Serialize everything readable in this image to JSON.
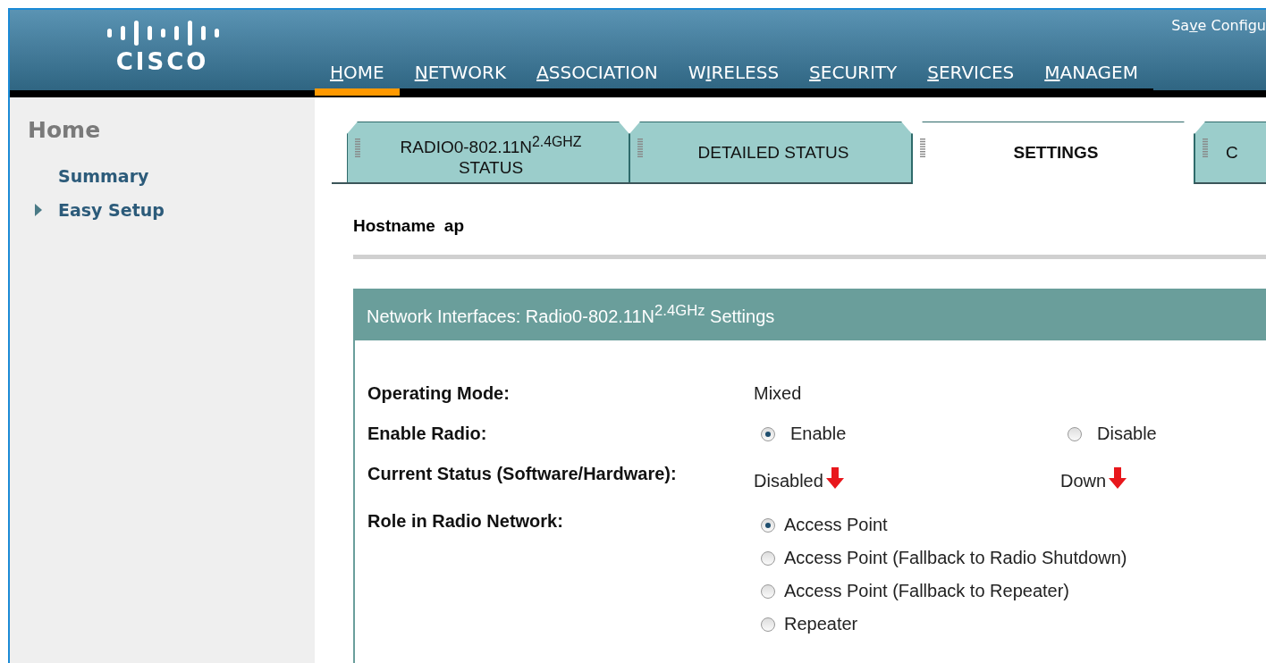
{
  "header": {
    "logo": "CISCO",
    "save_link": {
      "before": "Sa",
      "key": "v",
      "after": "e Configu"
    },
    "nav": [
      {
        "key": "H",
        "after": "OME",
        "selected": true
      },
      {
        "key": "N",
        "after": "ETWORK",
        "selected": false
      },
      {
        "key": "A",
        "after": "SSOCIATION",
        "selected": false
      },
      {
        "before": "W",
        "key": "I",
        "after": "RELESS",
        "selected": false
      },
      {
        "key": "S",
        "after": "ECURITY",
        "selected": false
      },
      {
        "key": "S",
        "after": "ERVICES",
        "selected": false
      },
      {
        "key": "M",
        "after": "ANAGEM",
        "selected": false
      }
    ]
  },
  "sidebar": {
    "title": "Home",
    "items": [
      {
        "label": "Summary",
        "expandable": false
      },
      {
        "label": "Easy Setup",
        "expandable": true
      }
    ]
  },
  "tabs": [
    {
      "label": "RADIO0-802.11N$^{2.4GHZ}$ STATUS",
      "selected": false
    },
    {
      "label": "DETAILED STATUS",
      "selected": false
    },
    {
      "label": "SETTINGS",
      "selected": true
    },
    {
      "label": "C",
      "selected": false
    }
  ],
  "hostname": {
    "label": "Hostname",
    "value": "ap"
  },
  "panel": {
    "title": "Network Interfaces: Radio0-802.11N$^{2.4GHz}$ Settings",
    "rows": [
      {
        "kind": "text",
        "label": "Operating Mode:",
        "value": "Mixed"
      },
      {
        "kind": "radio-inline",
        "label": "Enable Radio:",
        "options": [
          {
            "label": "Enable",
            "selected": true
          },
          {
            "label": "Disable",
            "selected": false
          }
        ]
      },
      {
        "kind": "status",
        "label": "Current Status (Software/Hardware):",
        "values": [
          {
            "text": "Disabled",
            "down": true
          },
          {
            "text": "Down",
            "down": true
          }
        ]
      },
      {
        "kind": "radio-list",
        "label": "Role in Radio Network:",
        "options": [
          {
            "label": "Access Point",
            "selected": true
          },
          {
            "label": "Access Point (Fallback to Radio Shutdown)",
            "selected": false
          },
          {
            "label": "Access Point (Fallback to Repeater)",
            "selected": false
          },
          {
            "label": "Repeater",
            "selected": false
          }
        ]
      }
    ]
  }
}
